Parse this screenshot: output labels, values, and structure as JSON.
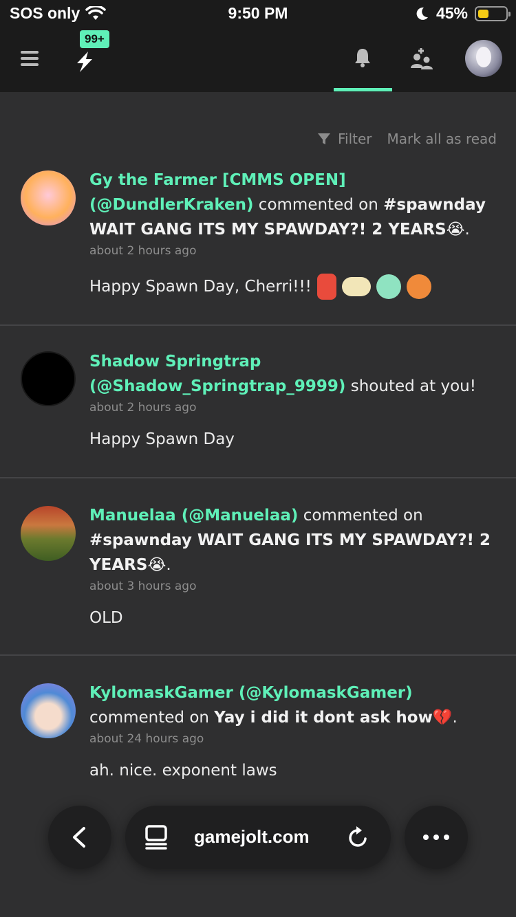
{
  "status_bar": {
    "carrier": "SOS only",
    "time": "9:50 PM",
    "battery": "45%"
  },
  "topnav": {
    "badge": "99+"
  },
  "filters": {
    "filter_label": "Filter",
    "mark_all_label": "Mark all as read"
  },
  "notifications": [
    {
      "user": "Gy the Farmer [CMMS OPEN] (@DundlerKraken)",
      "action": " commented on ",
      "target": "#spawnday WAIT GANG ITS MY SPAWDAY?! 2 YEARS😭",
      "suffix": ".",
      "time": "about 2 hours ago",
      "message": "Happy Spawn Day, Cherri!!!"
    },
    {
      "user": "Shadow Springtrap (@Shadow_Springtrap_9999)",
      "action": " shouted at you!",
      "target": "",
      "suffix": "",
      "time": "about 2 hours ago",
      "message": "Happy Spawn Day"
    },
    {
      "user": "Manuelaa (@Manuelaa)",
      "action": " commented on ",
      "target": "#spawnday WAIT GANG ITS MY SPAWDAY?! 2 YEARS😭",
      "suffix": ".",
      "time": "about 3 hours ago",
      "message": "OLD"
    },
    {
      "user": "KylomaskGamer (@KylomaskGamer)",
      "action": " commented on ",
      "target": "Yay i did it dont ask how💔",
      "suffix": ".",
      "time": "about 24 hours ago",
      "message": "ah. nice. exponent laws"
    }
  ],
  "browser_bar": {
    "url": "gamejolt.com"
  },
  "colors": {
    "accent": "#5ff0b8",
    "background": "#2f2f30",
    "header": "#1b1b1b"
  }
}
